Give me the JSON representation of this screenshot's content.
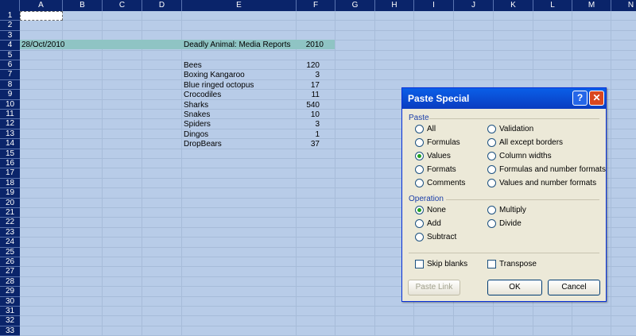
{
  "columns": [
    "A",
    "B",
    "C",
    "D",
    "E",
    "F",
    "G",
    "H",
    "I",
    "J",
    "K",
    "L",
    "M",
    "N"
  ],
  "rows": [
    "1",
    "2",
    "3",
    "4",
    "5",
    "6",
    "7",
    "8",
    "9",
    "10",
    "11",
    "12",
    "13",
    "14",
    "15",
    "16",
    "17",
    "18",
    "19",
    "20",
    "21",
    "22",
    "23",
    "24",
    "25",
    "26",
    "27",
    "28",
    "29",
    "30",
    "31",
    "32",
    "33"
  ],
  "sheet": {
    "date": "28/Oct/2010",
    "title": "Deadly Animal: Media Reports",
    "year": "2010",
    "animals": [
      {
        "name": "Bees",
        "count": "120"
      },
      {
        "name": "Boxing Kangaroo",
        "count": "3"
      },
      {
        "name": "Blue ringed octopus",
        "count": "17"
      },
      {
        "name": "Crocodiles",
        "count": "11"
      },
      {
        "name": "Sharks",
        "count": "540"
      },
      {
        "name": "Snakes",
        "count": "10"
      },
      {
        "name": "Spiders",
        "count": "3"
      },
      {
        "name": "Dingos",
        "count": "1"
      },
      {
        "name": "DropBears",
        "count": "37"
      }
    ]
  },
  "dialog": {
    "title": "Paste Special",
    "help_glyph": "?",
    "close_glyph": "✕",
    "paste_group": "Paste",
    "paste_left": [
      "All",
      "Formulas",
      "Values",
      "Formats",
      "Comments"
    ],
    "paste_right": [
      "Validation",
      "All except borders",
      "Column widths",
      "Formulas and number formats",
      "Values and number formats"
    ],
    "operation_group": "Operation",
    "op_left": [
      "None",
      "Add",
      "Subtract"
    ],
    "op_right": [
      "Multiply",
      "Divide"
    ],
    "skip_blanks": "Skip blanks",
    "transpose": "Transpose",
    "paste_link": "Paste Link",
    "ok": "OK",
    "cancel": "Cancel",
    "selected_paste": "Values",
    "selected_operation": "None"
  }
}
